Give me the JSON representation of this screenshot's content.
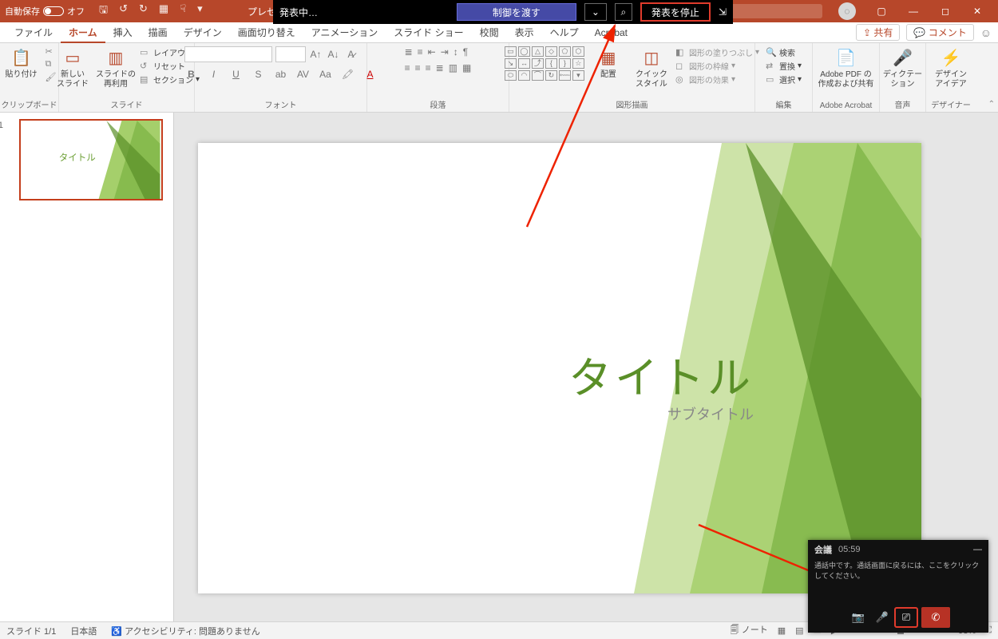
{
  "titlebar": {
    "autosave_label": "自動保存",
    "autosave_state": "オフ",
    "doc_title": "プレゼ"
  },
  "tabs": {
    "file": "ファイル",
    "home": "ホーム",
    "insert": "挿入",
    "draw": "描画",
    "design": "デザイン",
    "transitions": "画面切り替え",
    "animations": "アニメーション",
    "slideshow": "スライド ショー",
    "review": "校閲",
    "view": "表示",
    "help": "ヘルプ",
    "acrobat": "Acrobat",
    "share": "共有",
    "comments": "コメント"
  },
  "ribbon": {
    "clipboard": {
      "label": "クリップボード",
      "paste": "貼り付け"
    },
    "slides": {
      "label": "スライド",
      "new": "新しい\nスライド",
      "reuse": "スライドの\n再利用",
      "layout": "レイアウト",
      "reset": "リセット",
      "section": "セクション"
    },
    "font": {
      "label": "フォント"
    },
    "paragraph": {
      "label": "段落"
    },
    "drawing": {
      "label": "図形描画",
      "arrange": "配置",
      "quickstyle": "クイック\nスタイル",
      "fill": "図形の塗りつぶし",
      "outline": "図形の枠線",
      "effects": "図形の効果"
    },
    "editing": {
      "label": "編集",
      "find": "検索",
      "replace": "置換",
      "select": "選択"
    },
    "acrobat": {
      "label": "Adobe Acrobat",
      "btn": "Adobe PDF の\n作成および共有"
    },
    "voice": {
      "label": "音声",
      "btn": "ディクテー\nション"
    },
    "designer": {
      "label": "デザイナー",
      "btn": "デザイン\nアイデア"
    }
  },
  "slide": {
    "title": "タイトル",
    "subtitle": "サブタイトル"
  },
  "status": {
    "slide": "スライド 1/1",
    "lang": "日本語",
    "a11y": "アクセシビリティ: 問題ありません",
    "notes": "ノート",
    "zoom": "93%"
  },
  "teams_bar": {
    "presenting": "発表中…",
    "give_control": "制御を渡す",
    "stop": "発表を停止"
  },
  "call": {
    "title": "会議",
    "time": "05:59",
    "msg": "通話中です。通話画面に戻るには、ここをクリックしてください。"
  }
}
